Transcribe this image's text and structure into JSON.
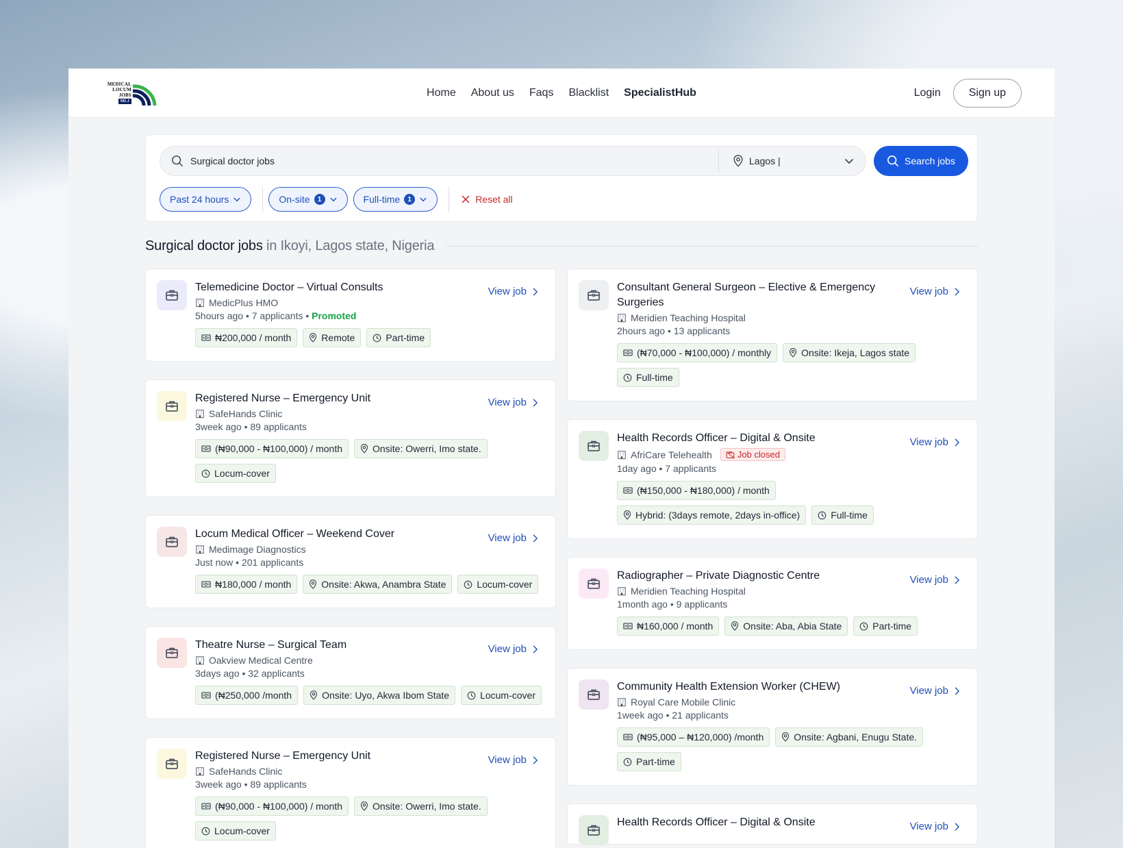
{
  "navbar": {
    "logo": {
      "line1": "MEDICAL",
      "line2": "LOCUM",
      "line3": "JOBS",
      "badge": "MLJ",
      "colors": {
        "green": "#3bb54a",
        "navy": "#0b1f5c"
      }
    },
    "links": [
      "Home",
      "About us",
      "Faqs",
      "Blacklist",
      "SpecialistHub"
    ],
    "login": "Login",
    "signup": "Sign up"
  },
  "search": {
    "query": "Surgical doctor jobs",
    "location": "Lagos |",
    "button": "Search jobs",
    "filters": [
      {
        "label": "Past 24 hours",
        "count": ""
      },
      {
        "label": "On-site",
        "count": "1"
      },
      {
        "label": "Full-time",
        "count": "1"
      }
    ],
    "reset": "Reset all"
  },
  "results": {
    "title": "Surgical doctor jobs",
    "location": "in Ikoyi, Lagos state, Nigeria"
  },
  "view_job_label": "View job",
  "left_jobs": [
    {
      "title": "Telemedicine Doctor – Virtual Consults",
      "company": "MedicPlus HMO",
      "meta": "5hours ago • 7 applicants • ",
      "promoted": "Promoted",
      "icon_bg": "#ecebfb",
      "tags": [
        [
          "money",
          "₦200,000 / month"
        ],
        [
          "pin",
          "Remote"
        ],
        [
          "clock",
          "Part-time"
        ]
      ]
    },
    {
      "title": "Registered Nurse – Emergency Unit",
      "company": "SafeHands Clinic",
      "meta": "3week ago • 89 applicants",
      "icon_bg": "#fbf8df",
      "tags": [
        [
          "money",
          "(₦90,000 - ₦100,000) / month"
        ],
        [
          "pin",
          "Onsite: Owerri, Imo state."
        ],
        [
          "clock",
          "Locum-cover"
        ]
      ]
    },
    {
      "title": "Locum Medical Officer – Weekend Cover",
      "company": "Medimage Diagnostics",
      "meta": "Just now • 201 applicants",
      "icon_bg": "#f7e6e6",
      "tags": [
        [
          "money",
          "₦180,000 / month"
        ],
        [
          "pin",
          "Onsite: Akwa, Anambra State"
        ],
        [
          "clock",
          "Locum-cover"
        ]
      ]
    },
    {
      "title": "Theatre Nurse – Surgical Team",
      "company": "Oakview Medical Centre",
      "meta": "3days ago • 32 applicants",
      "icon_bg": "#fbe4e4",
      "tags": [
        [
          "money",
          "(₦250,000 /month"
        ],
        [
          "pin",
          "Onsite: Uyo, Akwa Ibom State"
        ],
        [
          "clock",
          "Locum-cover"
        ]
      ]
    },
    {
      "title": "Registered Nurse – Emergency Unit",
      "company": "SafeHands Clinic",
      "meta": "3week ago • 89 applicants",
      "icon_bg": "#fbf8df",
      "tags": [
        [
          "money",
          "(₦90,000 - ₦100,000) / month"
        ],
        [
          "pin",
          "Onsite: Owerri, Imo state."
        ],
        [
          "clock",
          "Locum-cover"
        ]
      ]
    }
  ],
  "right_jobs": [
    {
      "title": "Consultant General Surgeon – Elective & Emergency Surgeries",
      "company": "Meridien Teaching Hospital",
      "meta": "2hours ago • 13 applicants",
      "icon_bg": "#eeeff1",
      "tags": [
        [
          "money",
          "(₦70,000 - ₦100,000) / monthly"
        ],
        [
          "pin",
          "Onsite: Ikeja, Lagos state"
        ],
        [
          "clock",
          "Full-time"
        ]
      ]
    },
    {
      "title": "Health Records Officer – Digital & Onsite",
      "company": "AfriCare Telehealth",
      "closed": "Job closed",
      "meta": "1day ago • 7 applicants",
      "icon_bg": "#e3eee3",
      "tags": [
        [
          "money",
          "(₦150,000 - ₦180,000) / month"
        ],
        [
          "pin",
          "Hybrid: (3days remote, 2days in-office)"
        ],
        [
          "clock",
          "Full-time"
        ]
      ]
    },
    {
      "title": "Radiographer – Private Diagnostic Centre",
      "company": "Meridien Teaching Hospital",
      "meta": "1month ago • 9 applicants",
      "icon_bg": "#fbeaf6",
      "tags": [
        [
          "money",
          "₦160,000 / month"
        ],
        [
          "pin",
          "Onsite: Aba, Abia State"
        ],
        [
          "clock",
          "Part-time"
        ]
      ]
    },
    {
      "title": "Community Health Extension Worker (CHEW)",
      "company": "Royal Care Mobile Clinic",
      "meta": "1week ago • 21 applicants",
      "icon_bg": "#efe4f1",
      "tags": [
        [
          "money",
          "(₦95,000 – ₦120,000) /month"
        ],
        [
          "pin",
          "Onsite: Agbani, Enugu State."
        ],
        [
          "clock",
          "Part-time"
        ]
      ]
    },
    {
      "title": "Health Records Officer – Digital & Onsite",
      "company": "",
      "meta": "",
      "icon_bg": "#e3eee3",
      "tags": []
    }
  ]
}
